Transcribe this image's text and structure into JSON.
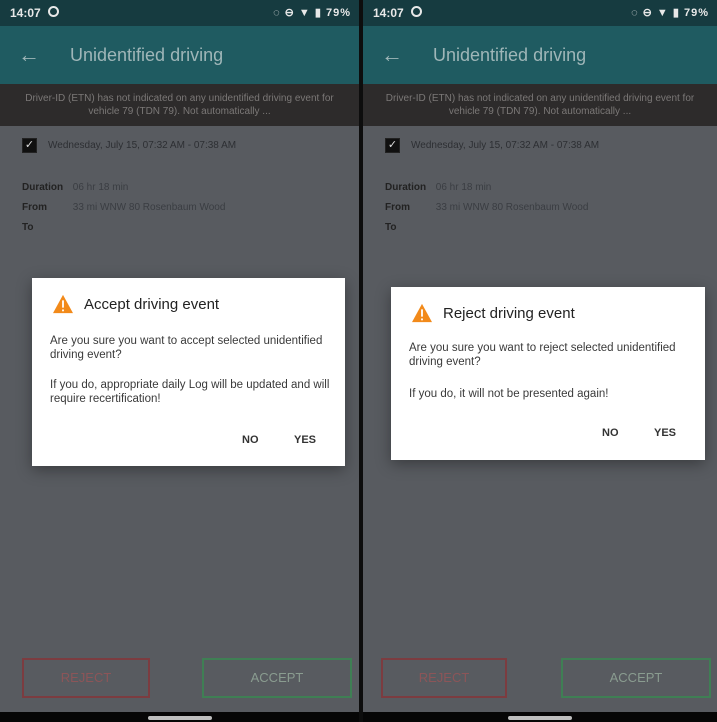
{
  "status_bar": {
    "time": "14:07",
    "system_text": "◌ ⊖ ▼ ▮ 79%"
  },
  "app_bar": {
    "title": "Unidentified driving",
    "back_icon": "back-arrow-icon"
  },
  "notice_text": "Driver-ID (ETN) has not indicated on any unidentified driving event for vehicle 79 (TDN 79). Not automatically ...",
  "event": {
    "checkbox_checked": true,
    "label": "Wednesday, July 15, 07:32 AM - 07:38 AM",
    "details": [
      {
        "key": "Duration",
        "value": "06 hr 18 min"
      },
      {
        "key": "From",
        "value": "33 mi WNW 80 Rosenbaum Wood"
      },
      {
        "key": "To",
        "value": ""
      }
    ]
  },
  "buttons": {
    "reject": "REJECT",
    "accept": "ACCEPT"
  },
  "dialogs": {
    "accept": {
      "title": "Accept driving event",
      "message_1": "Are you sure you want to accept selected unidentified driving event?",
      "message_2": "If you do, appropriate daily Log will be updated and will require recertification!",
      "no": "NO",
      "yes": "YES"
    },
    "reject": {
      "title": "Reject driving event",
      "message_1": "Are you sure you want to reject selected unidentified driving event?",
      "message_2": "If you do, it will not be presented again!",
      "no": "NO",
      "yes": "YES"
    }
  },
  "colors": {
    "status_bar": "#163b40",
    "app_bar": "#1f5b61",
    "warning": "#f28a1a",
    "reject_border": "#7c3c40",
    "accept_border": "#3f7f54"
  }
}
